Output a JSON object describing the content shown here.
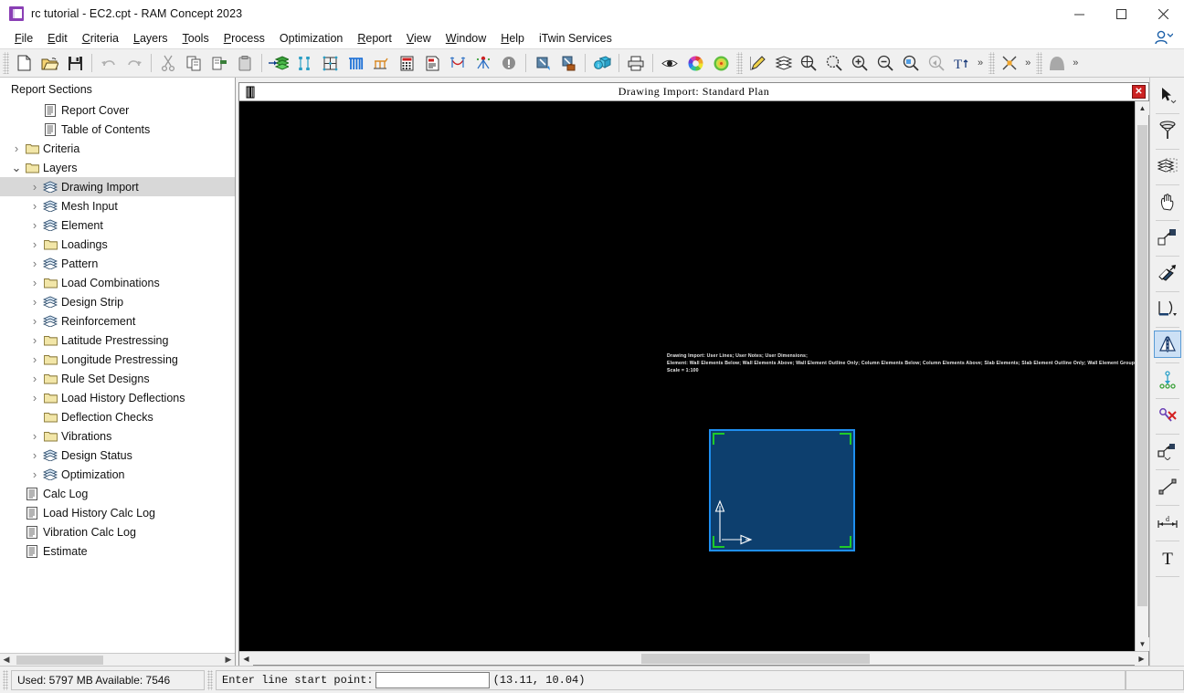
{
  "window": {
    "title": "rc tutorial - EC2.cpt - RAM Concept 2023",
    "minimize": "—",
    "maximize": "☐",
    "close": "✕"
  },
  "menubar": {
    "items": [
      {
        "label": "File",
        "accel": "F"
      },
      {
        "label": "Edit",
        "accel": "E"
      },
      {
        "label": "Criteria",
        "accel": "C"
      },
      {
        "label": "Layers",
        "accel": "L"
      },
      {
        "label": "Tools",
        "accel": "T"
      },
      {
        "label": "Process",
        "accel": "P"
      },
      {
        "label": "Optimization",
        "accel": ""
      },
      {
        "label": "Report",
        "accel": "R"
      },
      {
        "label": "View",
        "accel": "V"
      },
      {
        "label": "Window",
        "accel": "W"
      },
      {
        "label": "Help",
        "accel": "H"
      },
      {
        "label": "iTwin Services",
        "accel": ""
      }
    ]
  },
  "toolbar": {
    "groups": [
      {
        "buttons": [
          {
            "name": "new-file-icon",
            "label": "New"
          },
          {
            "name": "open-file-icon",
            "label": "Open"
          },
          {
            "name": "save-file-icon",
            "label": "Save"
          }
        ]
      },
      {
        "buttons": [
          {
            "name": "undo-icon",
            "label": "Undo"
          },
          {
            "name": "redo-icon",
            "label": "Redo"
          }
        ]
      },
      {
        "buttons": [
          {
            "name": "cut-icon",
            "label": "Cut"
          },
          {
            "name": "copy-icon",
            "label": "Copy"
          },
          {
            "name": "paste-icon",
            "label": "Paste"
          },
          {
            "name": "clipboard-icon",
            "label": "Clipboard"
          }
        ]
      },
      {
        "buttons": [
          {
            "name": "drawing-import-icon",
            "label": "Drawing Import"
          },
          {
            "name": "mesh-input-icon",
            "label": "Mesh Input"
          },
          {
            "name": "element-grid-icon",
            "label": "Element"
          },
          {
            "name": "design-strip-icon",
            "label": "Design Strip"
          },
          {
            "name": "loadings-icon",
            "label": "Loadings"
          },
          {
            "name": "calc-all-icon",
            "label": "Calc All"
          },
          {
            "name": "report-icon",
            "label": "Report"
          },
          {
            "name": "latitude-prestressing-icon",
            "label": "Latitude Tendon"
          },
          {
            "name": "longitude-prestressing-icon",
            "label": "Longitude Tendon"
          },
          {
            "name": "warning-icon",
            "label": "Errors"
          }
        ]
      },
      {
        "buttons": [
          {
            "name": "select-window-icon",
            "label": "Select Window"
          },
          {
            "name": "select-case-icon",
            "label": "Select Case"
          }
        ]
      },
      {
        "buttons": [
          {
            "name": "info-3d-icon",
            "label": "3D Info"
          }
        ]
      },
      {
        "buttons": [
          {
            "name": "print-icon",
            "label": "Print"
          }
        ]
      },
      {
        "buttons": [
          {
            "name": "visibility-icon",
            "label": "Visibility"
          },
          {
            "name": "color-wheel-icon",
            "label": "Colors"
          },
          {
            "name": "contour-icon",
            "label": "Contours"
          }
        ]
      },
      {
        "buttons": [
          {
            "name": "pencil-ruler-icon",
            "label": "Edit Drawing"
          },
          {
            "name": "layers-stack-icon",
            "label": "Layers"
          },
          {
            "name": "zoom-extents-icon",
            "label": "Zoom Extents"
          },
          {
            "name": "zoom-selection-icon",
            "label": "Zoom Selection"
          },
          {
            "name": "zoom-in-icon",
            "label": "Zoom In"
          },
          {
            "name": "zoom-out-icon",
            "label": "Zoom Out"
          },
          {
            "name": "zoom-window-icon",
            "label": "Zoom Window"
          },
          {
            "name": "zoom-previous-icon",
            "label": "Zoom Previous"
          },
          {
            "name": "text-size-icon",
            "label": "Text Size"
          }
        ],
        "overflow": "»"
      },
      {
        "buttons": [
          {
            "name": "snap-cross-icon",
            "label": "Snap"
          }
        ],
        "overflow": "»"
      },
      {
        "buttons": [
          {
            "name": "shape-fill-icon",
            "label": "Shape"
          }
        ],
        "overflow": "»"
      }
    ]
  },
  "sidebar": {
    "header": "Report Sections",
    "items": [
      {
        "label": "Report Cover",
        "icon": "document-icon",
        "indent": 1,
        "chevron": "none",
        "selected": false
      },
      {
        "label": "Table of Contents",
        "icon": "document-icon",
        "indent": 1,
        "chevron": "none",
        "selected": false
      },
      {
        "label": "Criteria",
        "icon": "folder-icon",
        "indent": 0,
        "chevron": "collapsed",
        "selected": false
      },
      {
        "label": "Layers",
        "icon": "folder-icon",
        "indent": 0,
        "chevron": "expanded",
        "selected": false
      },
      {
        "label": "Drawing Import",
        "icon": "layers-icon",
        "indent": 1,
        "chevron": "collapsed",
        "selected": true
      },
      {
        "label": "Mesh Input",
        "icon": "layers-icon",
        "indent": 1,
        "chevron": "collapsed",
        "selected": false
      },
      {
        "label": "Element",
        "icon": "layers-icon",
        "indent": 1,
        "chevron": "collapsed",
        "selected": false
      },
      {
        "label": "Loadings",
        "icon": "folder-icon",
        "indent": 1,
        "chevron": "collapsed",
        "selected": false
      },
      {
        "label": "Pattern",
        "icon": "layers-icon",
        "indent": 1,
        "chevron": "collapsed",
        "selected": false
      },
      {
        "label": "Load Combinations",
        "icon": "folder-icon",
        "indent": 1,
        "chevron": "collapsed",
        "selected": false
      },
      {
        "label": "Design Strip",
        "icon": "layers-icon",
        "indent": 1,
        "chevron": "collapsed",
        "selected": false
      },
      {
        "label": "Reinforcement",
        "icon": "layers-icon",
        "indent": 1,
        "chevron": "collapsed",
        "selected": false
      },
      {
        "label": "Latitude Prestressing",
        "icon": "folder-icon",
        "indent": 1,
        "chevron": "collapsed",
        "selected": false
      },
      {
        "label": "Longitude Prestressing",
        "icon": "folder-icon",
        "indent": 1,
        "chevron": "collapsed",
        "selected": false
      },
      {
        "label": "Rule Set Designs",
        "icon": "folder-icon",
        "indent": 1,
        "chevron": "collapsed",
        "selected": false
      },
      {
        "label": "Load History Deflections",
        "icon": "folder-icon",
        "indent": 1,
        "chevron": "collapsed",
        "selected": false
      },
      {
        "label": "Deflection Checks",
        "icon": "folder-icon",
        "indent": 1,
        "chevron": "none",
        "selected": false
      },
      {
        "label": "Vibrations",
        "icon": "folder-icon",
        "indent": 1,
        "chevron": "collapsed",
        "selected": false
      },
      {
        "label": "Design Status",
        "icon": "layers-icon",
        "indent": 1,
        "chevron": "collapsed",
        "selected": false
      },
      {
        "label": "Optimization",
        "icon": "layers-icon",
        "indent": 1,
        "chevron": "collapsed",
        "selected": false
      },
      {
        "label": "Calc Log",
        "icon": "document-icon",
        "indent": 0,
        "chevron": "none",
        "selected": false
      },
      {
        "label": "Load History Calc Log",
        "icon": "document-icon",
        "indent": 0,
        "chevron": "none",
        "selected": false
      },
      {
        "label": "Vibration Calc Log",
        "icon": "document-icon",
        "indent": 0,
        "chevron": "none",
        "selected": false
      },
      {
        "label": "Estimate",
        "icon": "document-icon",
        "indent": 0,
        "chevron": "none",
        "selected": false
      }
    ]
  },
  "document": {
    "title": "Drawing Import: Standard Plan",
    "close_label": "✕",
    "canvas": {
      "background_color": "#000000",
      "annotation_lines": [
        "Drawing Import: User Lines; User Notes; User Dimensions;",
        "Element: Wall Elements Below; Wall Elements Above; Wall Element Outline Only; Column Elements Below; Column Elements Above; Slab Elements; Slab Element Outline Only; Wall Element Groups Above; Wall Element Groups Below;",
        "Scale = 1:100"
      ],
      "slab": {
        "fill_color": "#0d3f6e",
        "outline_color": "#1f8ff0",
        "corner_marker_color": "#1ecb2a",
        "axis_color": "#ffffff"
      }
    }
  },
  "right_toolbar": {
    "buttons": [
      {
        "name": "pointer-select-icon",
        "label": "Select",
        "active": false,
        "dropdown": true
      },
      {
        "name": "filter-funnel-icon",
        "label": "Filter Selection",
        "active": false,
        "dropdown": false
      },
      {
        "name": "select-stack-icon",
        "label": "Select Stack",
        "active": false,
        "dropdown": false
      },
      {
        "name": "pan-hand-icon",
        "label": "Pan",
        "active": false,
        "dropdown": false
      },
      {
        "name": "move-icon",
        "label": "Move",
        "active": false,
        "dropdown": false
      },
      {
        "name": "rotate-icon",
        "label": "Rotate",
        "active": false,
        "dropdown": false
      },
      {
        "name": "offset-icon",
        "label": "Offset",
        "active": false,
        "dropdown": false
      },
      {
        "name": "mirror-icon",
        "label": "Mirror",
        "active": true,
        "dropdown": false
      },
      {
        "name": "snap-point-icon",
        "label": "Snap Point",
        "active": false,
        "dropdown": false
      },
      {
        "name": "delete-snap-icon",
        "label": "Delete Snap",
        "active": false,
        "dropdown": false
      },
      {
        "name": "scale-icon",
        "label": "Scale",
        "active": false,
        "dropdown": true
      },
      {
        "name": "draw-line-icon",
        "label": "Draw Line",
        "active": false,
        "dropdown": false
      },
      {
        "name": "dimension-icon",
        "label": "Dimension",
        "active": false,
        "dropdown": false
      },
      {
        "name": "text-tool-icon",
        "label": "Text",
        "active": false,
        "dropdown": false
      }
    ]
  },
  "statusbar": {
    "memory": "Used: 5797 MB  Available: 7546",
    "command_label": "Enter line start point:",
    "command_value": "",
    "command_placeholder": "",
    "coordinates": "(13.11, 10.04)"
  }
}
